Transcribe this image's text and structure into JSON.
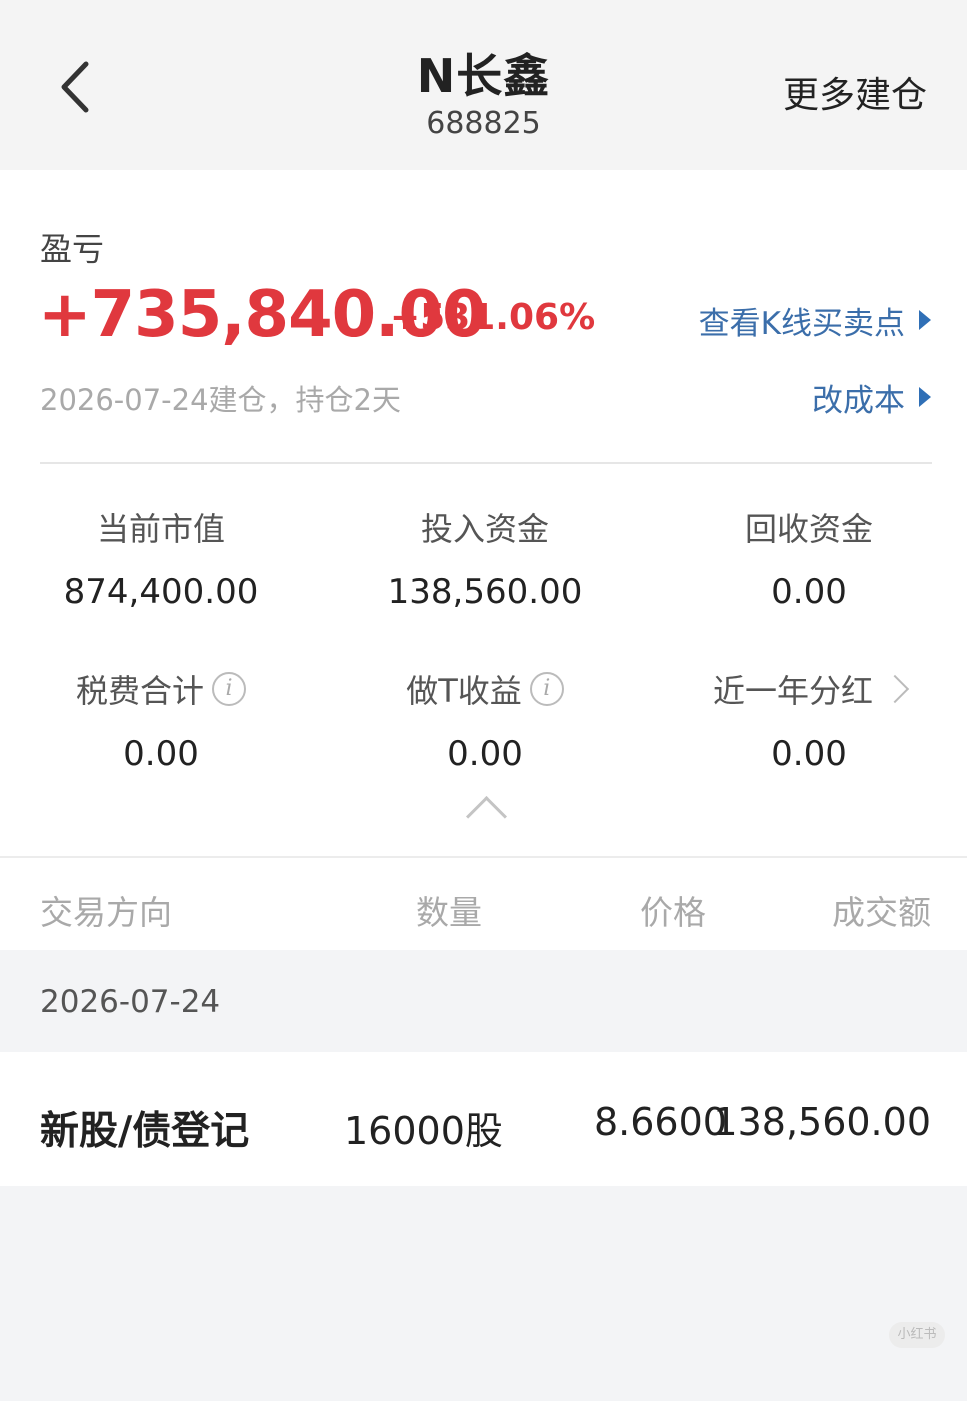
{
  "header": {
    "title": "N长鑫",
    "code": "688825",
    "more_label": "更多建仓"
  },
  "summary": {
    "pl_label": "盈亏",
    "pl_value": "+735,840.00",
    "pl_percent": "+531.06%",
    "kline_link": "查看K线买卖点",
    "date_line": "2026-07-24建仓，持仓2天",
    "cost_link": "改成本",
    "colors": {
      "profit": "#e0383e",
      "link": "#3b6eaa"
    }
  },
  "stats": [
    {
      "label": "当前市值",
      "value": "874,400.00"
    },
    {
      "label": "投入资金",
      "value": "138,560.00"
    },
    {
      "label": "回收资金",
      "value": "0.00"
    },
    {
      "label": "税费合计",
      "value": "0.00",
      "icon": "info-icon"
    },
    {
      "label": "做T收益",
      "value": "0.00",
      "icon": "info-icon"
    },
    {
      "label": "近一年分红",
      "value": "0.00",
      "icon": "chevron-right-icon"
    }
  ],
  "table": {
    "headers": [
      "交易方向",
      "数量",
      "价格",
      "成交额"
    ],
    "groups": [
      {
        "date": "2026-07-24",
        "rows": [
          {
            "direction": "新股/债登记",
            "quantity": "16000股",
            "price": "8.6600",
            "amount": "138,560.00"
          }
        ]
      }
    ]
  },
  "watermark": "小红书"
}
